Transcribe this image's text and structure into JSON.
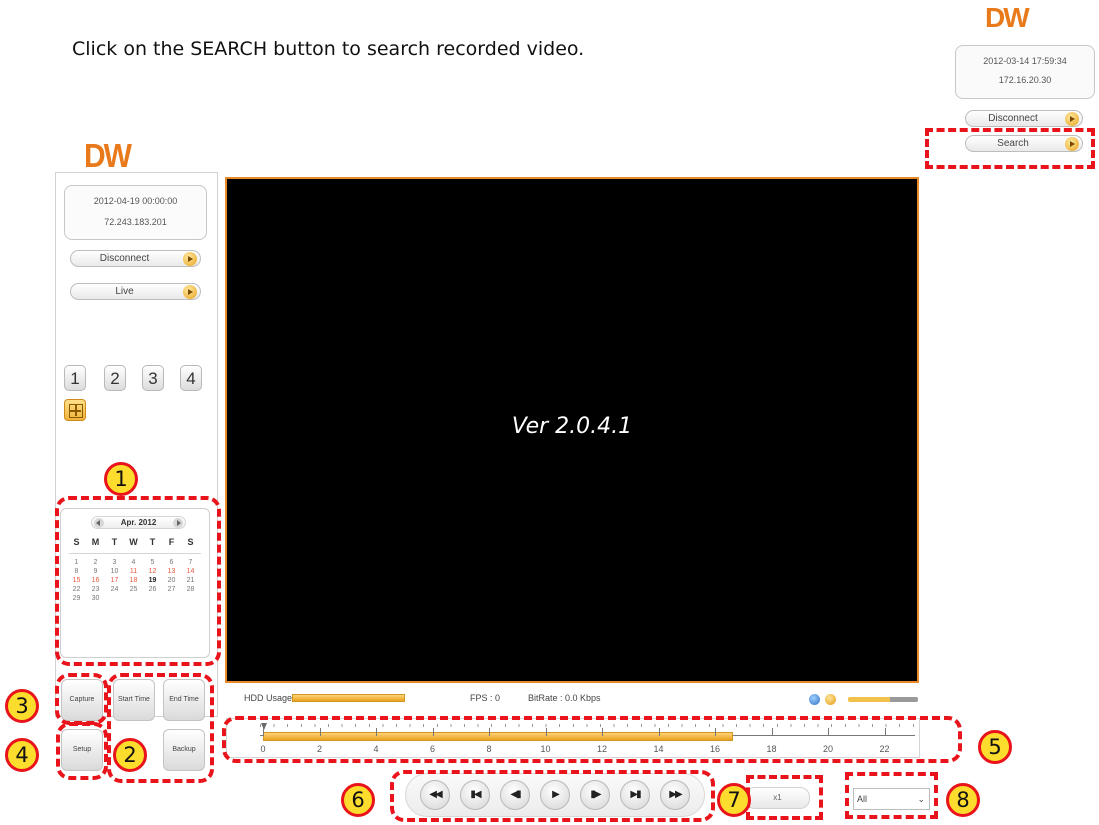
{
  "instruction": "Click on the SEARCH button to search recorded video.",
  "logo": "DW",
  "inset": {
    "datetime": "2012-03-14 17:59:34",
    "ip": "172.16.20.30",
    "disconnect_label": "Disconnect",
    "search_label": "Search"
  },
  "left_panel": {
    "datetime": "2012-04-19 00:00:00",
    "ip": "72.243.183.201",
    "disconnect_label": "Disconnect",
    "live_label": "Live",
    "channels": [
      "1",
      "2",
      "3",
      "4"
    ],
    "calendar": {
      "month_label": "Apr. 2012",
      "days_of_week": [
        "S",
        "M",
        "T",
        "W",
        "T",
        "F",
        "S"
      ],
      "days": [
        "1",
        "2",
        "3",
        "4",
        "5",
        "6",
        "7",
        "8",
        "9",
        "10",
        "11",
        "12",
        "13",
        "14",
        "15",
        "16",
        "17",
        "18",
        "19",
        "20",
        "21",
        "22",
        "23",
        "24",
        "25",
        "26",
        "27",
        "28",
        "29",
        "30"
      ],
      "recorded_days": [
        "11",
        "12",
        "13",
        "14",
        "15",
        "16",
        "17",
        "18"
      ],
      "selected_day": "19"
    },
    "buttons": {
      "capture": "Capture",
      "start_time": "Start Time",
      "end_time": "End Time",
      "setup": "Setup",
      "backup": "Backup"
    }
  },
  "video": {
    "version_text": "Ver 2.0.4.1"
  },
  "status_bar": {
    "hdd_label": "HDD Usage",
    "fps_label": "FPS : 0",
    "bitrate_label": "BitRate : 0.0 Kbps"
  },
  "timeline": {
    "hour_labels": [
      "0",
      "2",
      "4",
      "6",
      "8",
      "10",
      "12",
      "14",
      "16",
      "18",
      "20",
      "22"
    ]
  },
  "controls": {
    "buttons": [
      "◀◀",
      "▮◀",
      "◀▮",
      "▶",
      "▮▶",
      "▶▮",
      "▶▶"
    ]
  },
  "speed_label": "x1",
  "channel_select": {
    "selected": "All"
  },
  "annotations": [
    "1",
    "2",
    "3",
    "4",
    "5",
    "6",
    "7",
    "8"
  ],
  "colors": {
    "accent": "#e88a2a",
    "highlight": "#e8131b",
    "badge": "#fcdc2c",
    "recorded_day": "#e6593d"
  }
}
